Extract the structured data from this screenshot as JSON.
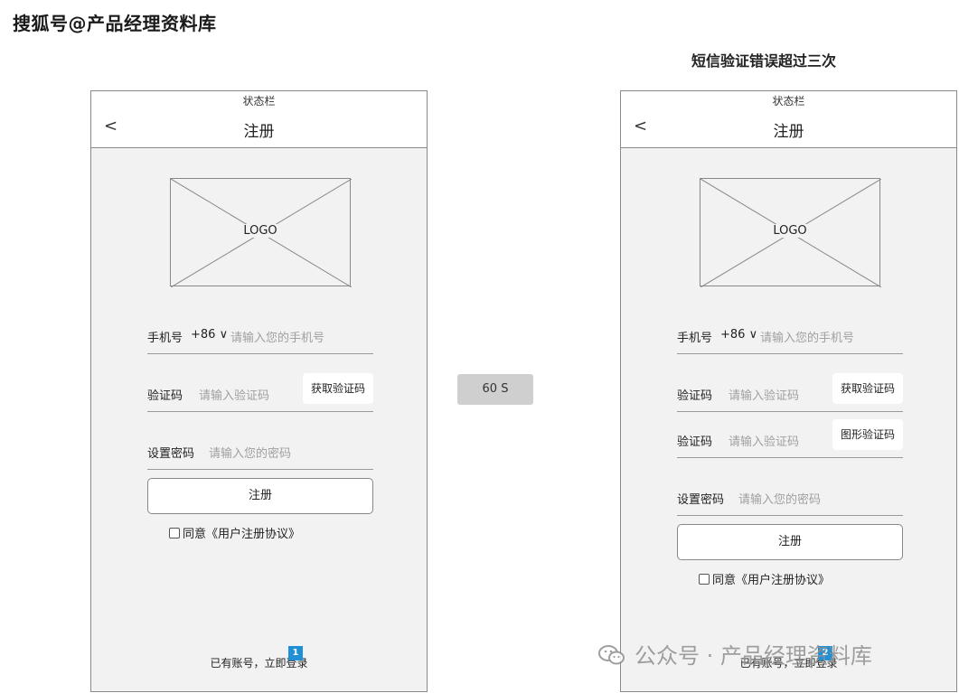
{
  "watermark_top": "搜狐号@产品经理资料库",
  "watermark_bottom": "公众号 · 产品经理资料库",
  "timer_label": "60 S",
  "frame2_title": "短信验证错误超过三次",
  "phones": [
    {
      "status_bar": "状态栏",
      "back": "<",
      "title": "注册",
      "logo": "LOGO",
      "phone_label": "手机号",
      "country_code": "+86 ∨",
      "phone_placeholder": "请输入您的手机号",
      "code_label": "验证码",
      "code_placeholder": "请输入验证码",
      "get_code_button": "获取验证码",
      "password_label": "设置密码",
      "password_placeholder": "请输入您的密码",
      "register_button": "注册",
      "agree_text": "同意《用户注册协议》",
      "login_link": "已有账号，立即登录",
      "badge": "1"
    },
    {
      "status_bar": "状态栏",
      "back": "<",
      "title": "注册",
      "logo": "LOGO",
      "phone_label": "手机号",
      "country_code": "+86 ∨",
      "phone_placeholder": "请输入您的手机号",
      "code_label": "验证码",
      "code_placeholder": "请输入验证码",
      "get_code_button": "获取验证码",
      "captcha_label": "验证码",
      "captcha_placeholder": "请输入验证码",
      "captcha_button": "图形验证码",
      "password_label": "设置密码",
      "password_placeholder": "请输入您的密码",
      "register_button": "注册",
      "agree_text": "同意《用户注册协议》",
      "login_link": "已有账号，立即登录",
      "badge": "2"
    }
  ],
  "icons": {
    "back": "chevron-left-icon",
    "checkbox": "checkbox-icon",
    "wechat": "wechat-icon"
  },
  "colors": {
    "page_bg": "#f2f2f2",
    "badge": "#1f8fd6",
    "timer_bg": "#cfcfcf"
  }
}
